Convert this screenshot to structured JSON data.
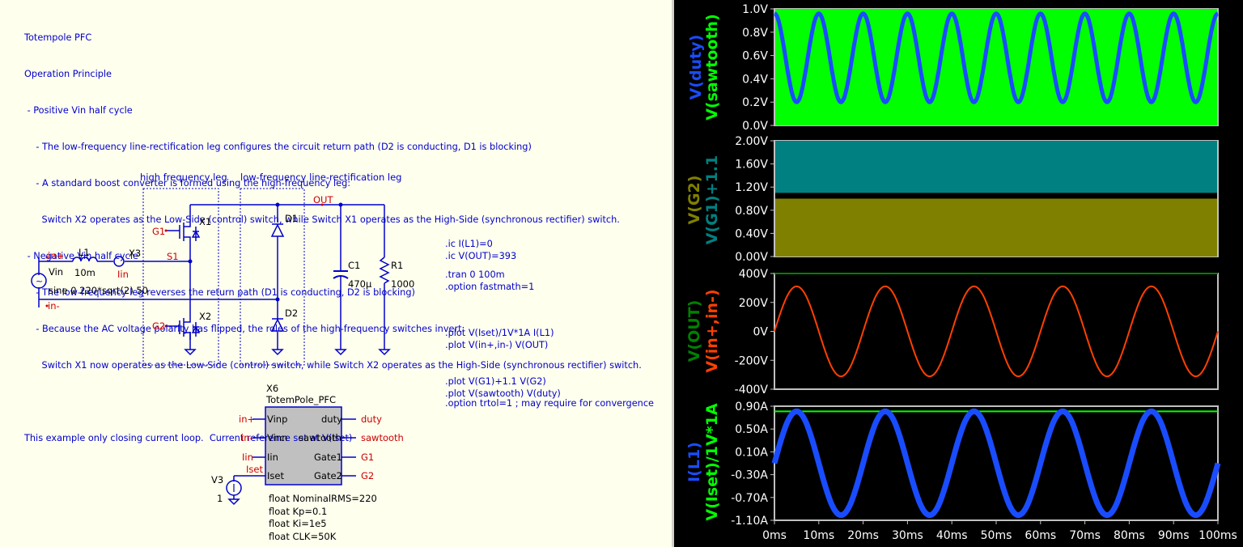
{
  "notes": [
    "Totempole PFC",
    "Operation Principle",
    " - Positive Vin half cycle",
    "    - The low-frequency line-rectification leg configures the circuit return path (D2 is conducting, D1 is blocking)",
    "    - A standard boost converter is formed using the high-frequency leg:",
    "      Switch X2 operates as the Low-Side (control) switch, while Switch X1 operates as the High-Side (synchronous rectifier) switch.",
    " - Negative Vin half cycle",
    "    - The low-frequency leg reverses the return path (D1 is conducting, D2 is blocking)",
    "    - Because the AC voltage polarity has flipped, the roles of the high-frequency switches invert:",
    "      Switch X1 now operates as the Low-Side (control) switch, while Switch X2 operates as the High-Side (synchronous rectifier) switch.",
    "",
    "This example only closing current loop.  Current reference set at V(Iset)"
  ],
  "schematic": {
    "hf_leg_label": "high frequency leg",
    "lf_leg_label": "low-frequency line-rectification leg",
    "out_label": "OUT",
    "d1": "D1",
    "d2": "D2",
    "x1": "X1",
    "x2": "X2",
    "x3": "X3",
    "g1": "G1",
    "g2": "G2",
    "s1": "S1",
    "c1": "C1",
    "c1_val": "470µ",
    "r1": "R1",
    "r1_val": "1000",
    "l1": "L1",
    "l1_val": "10m",
    "iin": "Iin",
    "inp": "in+",
    "inn": "in-",
    "vin": "Vin",
    "vin_val": "sine 0 220*sqrt(2) 50",
    "x6": "X6",
    "x6_name": "TotemPole_PFC",
    "pins_left": [
      "Vinp",
      "Vinn",
      "Iin",
      "Iset"
    ],
    "pins_right": [
      "duty",
      "sawtooth",
      "Gate1",
      "Gate2"
    ],
    "nets_left": [
      "in+",
      "in-",
      "Iin"
    ],
    "nets_right": [
      "duty",
      "sawtooth",
      "G1",
      "G2"
    ],
    "iset_net": "Iset",
    "v3": "V3",
    "v3_val": "1",
    "params": [
      "float NominalRMS=220",
      "float Kp=0.1",
      "float Ki=1e5",
      "float CLK=50K"
    ]
  },
  "directives_1": [
    ".ic I(L1)=0",
    ".ic V(OUT)=393"
  ],
  "directives_2": [
    ".tran 0 100m",
    ".option fastmath=1"
  ],
  "directives_3": [
    ".plot V(Iset)/1V*1A I(L1)",
    ".plot V(in+,in-) V(OUT)",
    ".plot V(G1)+1.1 V(G2)",
    ".plot V(sawtooth) V(duty)"
  ],
  "directives_4": [
    ".option trtol=1 ; may require for convergence"
  ],
  "colors": {
    "green": "#00ff00",
    "blue": "#1a4cff",
    "teal": "#008080",
    "olive": "#808000",
    "orange": "#ff4000",
    "darkgreen": "#008000"
  },
  "chart_data": [
    {
      "type": "line",
      "yticks": [
        "1.0V",
        "0.8V",
        "0.6V",
        "0.4V",
        "0.2V",
        "0.0V"
      ],
      "ylim": [
        0,
        1.0
      ],
      "xlim": [
        0,
        100
      ],
      "series": [
        {
          "name": "V(sawtooth)",
          "color": "#00ff00",
          "range": [
            0,
            1.0
          ],
          "note": "dense 50kHz sawtooth fills band"
        },
        {
          "name": "V(duty)",
          "color": "#1a4cff",
          "peaks": 0.96,
          "troughs": 0.2,
          "period_ms": 10
        }
      ]
    },
    {
      "type": "line",
      "yticks": [
        "2.00V",
        "1.60V",
        "1.20V",
        "0.80V",
        "0.40V",
        "0.00V"
      ],
      "ylim": [
        0,
        2.0
      ],
      "series": [
        {
          "name": "V(G1)+1.1",
          "color": "#008080",
          "range": [
            1.1,
            2.0
          ]
        },
        {
          "name": "V(G2)",
          "color": "#808000",
          "range": [
            0,
            1.0
          ]
        }
      ]
    },
    {
      "type": "line",
      "yticks": [
        "400V",
        "200V",
        "0V",
        "-200V",
        "-400V"
      ],
      "ylim": [
        -400,
        400
      ],
      "series": [
        {
          "name": "V(in+,in-)",
          "color": "#ff4000",
          "amplitude": 311,
          "freq_hz": 50
        },
        {
          "name": "V(OUT)",
          "color": "#008000",
          "value": 400
        }
      ]
    },
    {
      "type": "line",
      "yticks": [
        "0.90A",
        "0.50A",
        "0.10A",
        "-0.30A",
        "-0.70A",
        "-1.10A"
      ],
      "ylim": [
        -1.1,
        1.1
      ],
      "series": [
        {
          "name": "V(Iset)/1V*1A",
          "color": "#00ff00",
          "value": 1.0
        },
        {
          "name": "I(L1)",
          "color": "#1a4cff",
          "amplitude": 1.0,
          "freq_hz": 50
        }
      ],
      "xticks": [
        "0ms",
        "10ms",
        "20ms",
        "30ms",
        "40ms",
        "50ms",
        "60ms",
        "70ms",
        "80ms",
        "90ms",
        "100ms"
      ]
    }
  ],
  "plot_labels": {
    "p1": [
      "V(sawtooth)",
      "V(duty)"
    ],
    "p2": [
      "V(G1)+1.1",
      "V(G2)"
    ],
    "p3": [
      "V(in+,in-)",
      "V(OUT)"
    ],
    "p4": [
      "V(Iset)/1V*1A",
      "I(L1)"
    ]
  }
}
